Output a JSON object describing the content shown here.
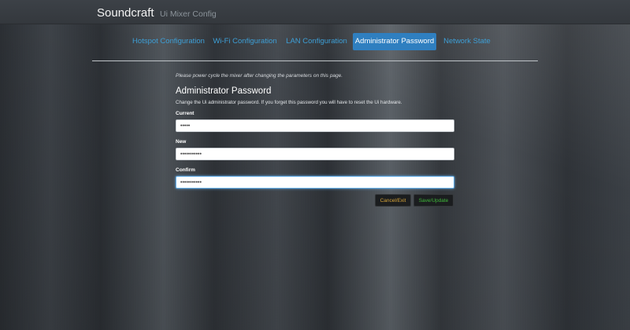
{
  "header": {
    "brand": "Soundcraft",
    "subtitle": "Ui Mixer Config"
  },
  "nav": {
    "tabs": [
      {
        "label": "Hotspot Configuration",
        "active": false
      },
      {
        "label": "Wi-Fi Configuration",
        "active": false
      },
      {
        "label": "LAN Configuration",
        "active": false
      },
      {
        "label": "Administrator Password",
        "active": true
      },
      {
        "label": "Network State",
        "active": false
      }
    ]
  },
  "main": {
    "notice": "Please power cycle the mixer after changing the parameters on this page.",
    "title": "Administrator Password",
    "description": "Change the Ui administrator password. If you forget this password you will have to reset the Ui hardware.",
    "fields": {
      "current": {
        "label": "Current",
        "value": "•••••"
      },
      "new": {
        "label": "New",
        "value": "•••••••••••"
      },
      "confirm": {
        "label": "Confirm",
        "value": "•••••••••••"
      }
    },
    "buttons": {
      "cancel": "Cancel/Exit",
      "save": "Save/Update"
    }
  },
  "colors": {
    "accent": "#2f7fc0",
    "link": "#3d9fd6",
    "cancel_text": "#d5a339",
    "save_text": "#3fb83a"
  }
}
